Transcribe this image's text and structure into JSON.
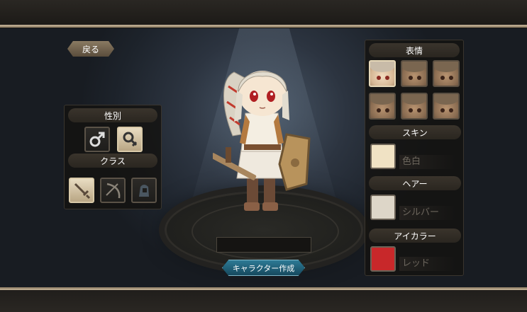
{
  "nav": {
    "back_label": "戻る"
  },
  "left_panel": {
    "gender_header": "性別",
    "gender_options": [
      {
        "icon": "male-icon",
        "selected": false
      },
      {
        "icon": "female-icon",
        "selected": true
      }
    ],
    "class_header": "クラス",
    "class_options": [
      {
        "icon": "sword-icon",
        "selected": true
      },
      {
        "icon": "bow-icon",
        "selected": false
      },
      {
        "icon": "mage-hood-icon",
        "selected": false
      }
    ]
  },
  "right_panel": {
    "expression_header": "表情",
    "expression_count": 6,
    "expression_selected_index": 0,
    "skin_header": "スキン",
    "skin_value": "色白",
    "skin_color": "#f0e2c4",
    "hair_header": "ヘアー",
    "hair_value": "シルバー",
    "hair_color": "#ddd6c8",
    "eye_header": "アイカラー",
    "eye_value": "レッド",
    "eye_color": "#c8282a"
  },
  "name_input": {
    "value": ""
  },
  "create_button": {
    "label": "キャラクター作成"
  },
  "colors": {
    "accent_gold": "#c8b69a",
    "button_teal": "#2d7a95"
  }
}
